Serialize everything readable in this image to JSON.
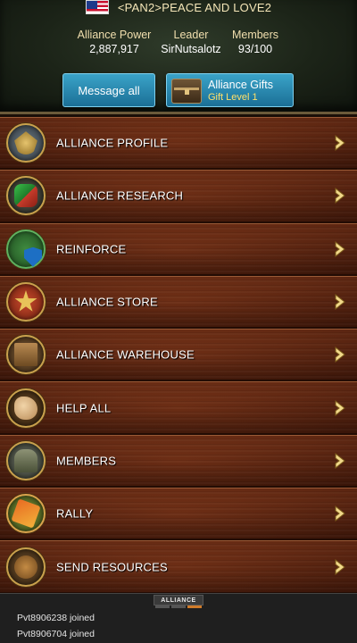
{
  "header": {
    "alliance_name": "<PAN2>PEACE AND LOVE2",
    "flag_icon": "us-flag-icon",
    "stats": {
      "power_label": "Alliance Power",
      "power_value": "2,887,917",
      "leader_label": "Leader",
      "leader_value": "SirNutsalotz",
      "members_label": "Members",
      "members_value": "93/100"
    },
    "message_button": "Message all",
    "gifts_button": {
      "title": "Alliance Gifts",
      "subtitle": "Gift Level 1",
      "icon": "treasure-chest-icon"
    }
  },
  "menu": {
    "items": [
      {
        "label": "ALLIANCE PROFILE",
        "icon": "eagle-emblem-icon"
      },
      {
        "label": "ALLIANCE RESEARCH",
        "icon": "research-flask-icon"
      },
      {
        "label": "REINFORCE",
        "icon": "shield-plus-icon"
      },
      {
        "label": "ALLIANCE STORE",
        "icon": "star-badge-icon"
      },
      {
        "label": "ALLIANCE WAREHOUSE",
        "icon": "crates-icon"
      },
      {
        "label": "HELP ALL",
        "icon": "handshake-icon"
      },
      {
        "label": "MEMBERS",
        "icon": "soldier-icon"
      },
      {
        "label": "RALLY",
        "icon": "map-flag-icon"
      },
      {
        "label": "SEND RESOURCES",
        "icon": "wagon-icon"
      }
    ]
  },
  "chat": {
    "tab_label": "ALLIANCE",
    "messages": [
      "Pvt8906238 joined",
      "Pvt8906704 joined"
    ]
  },
  "colors": {
    "accent_blue": "#2a8bb4",
    "gold_text": "#ffe06a",
    "wood_brown": "#5e2410",
    "chat_tab_active": "#d07b2a"
  }
}
